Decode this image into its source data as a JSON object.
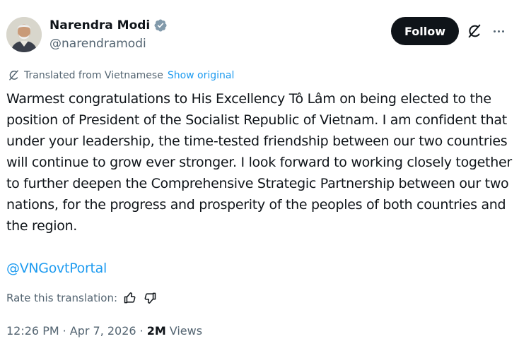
{
  "author": {
    "name": "Narendra Modi",
    "handle": "@narendramodi",
    "verified_color": "#829aab"
  },
  "header": {
    "follow_label": "Follow",
    "grok_icon": "grok-icon",
    "more_icon": "more-icon"
  },
  "translation": {
    "icon": "translate-icon",
    "label": "Translated from Vietnamese",
    "show_original": "Show original"
  },
  "post": {
    "body": "Warmest congratulations to His Excellency Tô Lâm on being elected to the position of President of the Socialist Republic of Vietnam. I am confident that under your leadership, the time-tested friendship between our two countries will continue to grow ever stronger. I look forward to working closely together to further deepen the Comprehensive Strategic Partnership between our two nations, for the progress and prosperity of the peoples of both countries and the region.",
    "mention": "@VNGovtPortal"
  },
  "rating": {
    "label": "Rate this translation:",
    "up_icon": "thumbs-up-icon",
    "down_icon": "thumbs-down-icon"
  },
  "meta": {
    "time": "12:26 PM",
    "separator": "·",
    "date": "Apr 7, 2026",
    "views_count": "2M",
    "views_label": "Views"
  },
  "colors": {
    "link": "#1d9bf0",
    "secondary_text": "#536471",
    "primary_text": "#0f1419",
    "follow_bg": "#0f1419"
  }
}
